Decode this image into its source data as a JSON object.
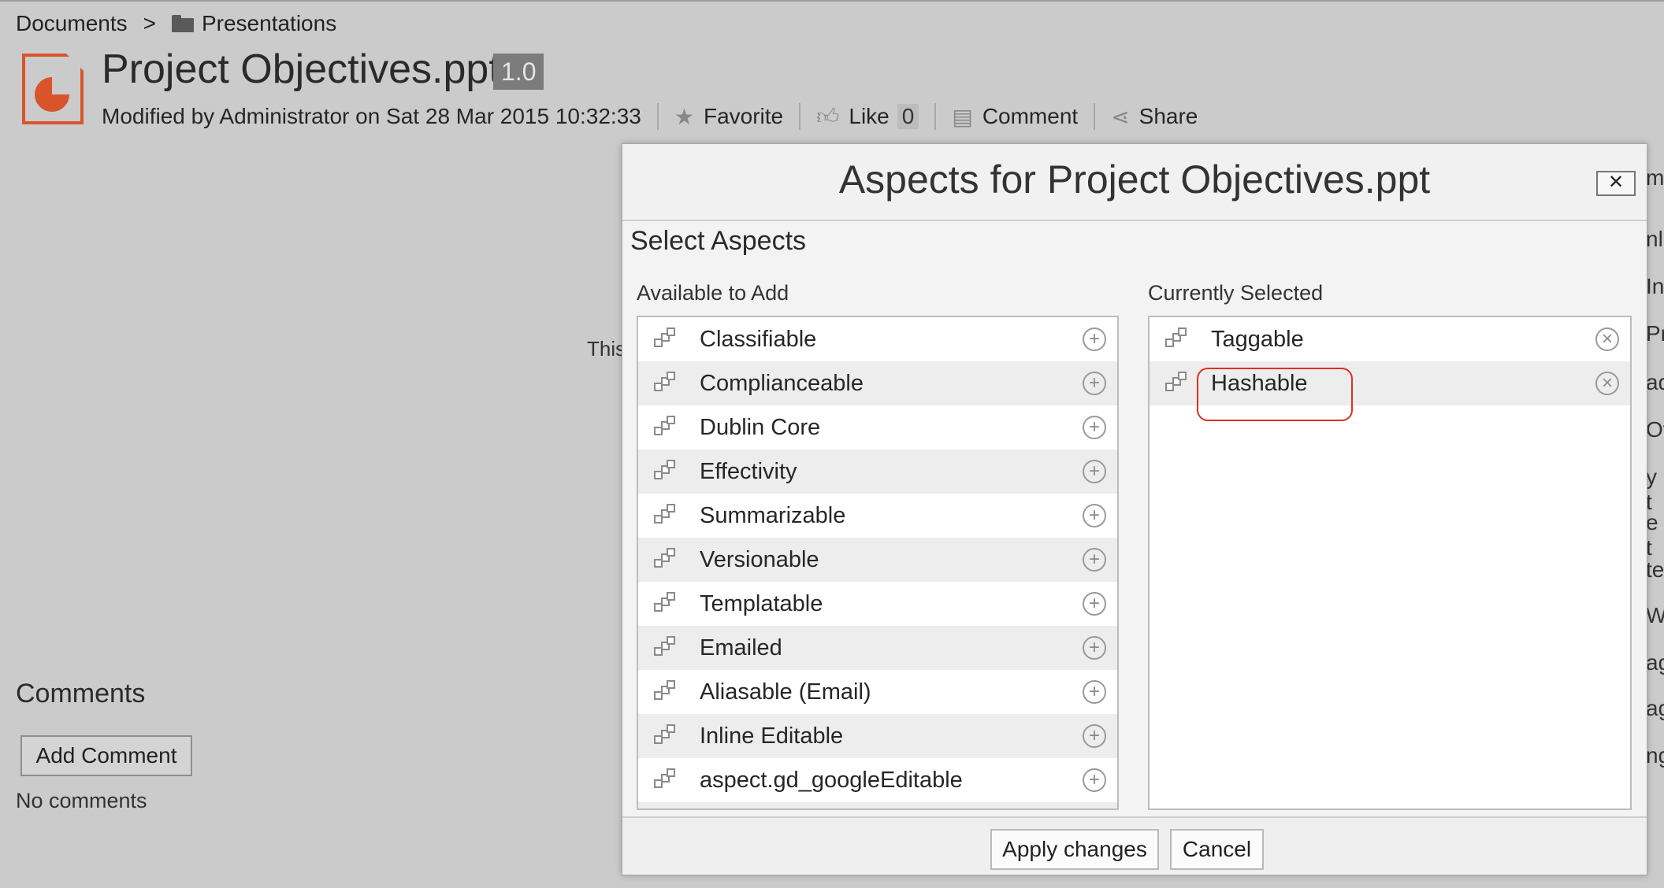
{
  "breadcrumb": {
    "root": "Documents",
    "separator": ">",
    "folder": "Presentations"
  },
  "document": {
    "title": "Project Objectives.ppt",
    "version": "1.0",
    "modified": "Modified by Administrator on Sat 28 Mar 2015 10:32:33",
    "actions": {
      "favorite": "Favorite",
      "like": "Like",
      "like_count": "0",
      "comment": "Comment",
      "share": "Share"
    }
  },
  "background_text": "This",
  "comments": {
    "heading": "Comments",
    "add_button": "Add Comment",
    "empty": "No comments"
  },
  "right_edge_fragments": [
    "m",
    "nl",
    "In",
    "Pr",
    "ad",
    "Of",
    "y t",
    "e t",
    "te",
    " W",
    "ag",
    "ag",
    "ng"
  ],
  "dialog": {
    "title": "Aspects for Project Objectives.ppt",
    "close_label": "✕",
    "section": "Select Aspects",
    "available_label": "Available to Add",
    "selected_label": "Currently Selected",
    "available": [
      "Classifiable",
      "Complianceable",
      "Dublin Core",
      "Effectivity",
      "Summarizable",
      "Versionable",
      "Templatable",
      "Emailed",
      "Aliasable (Email)",
      "Inline Editable",
      "aspect.gd_googleEditable"
    ],
    "selected": [
      "Taggable",
      "Hashable"
    ],
    "highlighted": "Hashable",
    "highlight_color": "#e0301e",
    "apply": "Apply changes",
    "cancel": "Cancel"
  },
  "colors": {
    "background": "#cbcbcb",
    "doc_icon": "#d9542b",
    "dialog_bg": "#f3f3f3",
    "row_alt": "#ededed"
  }
}
